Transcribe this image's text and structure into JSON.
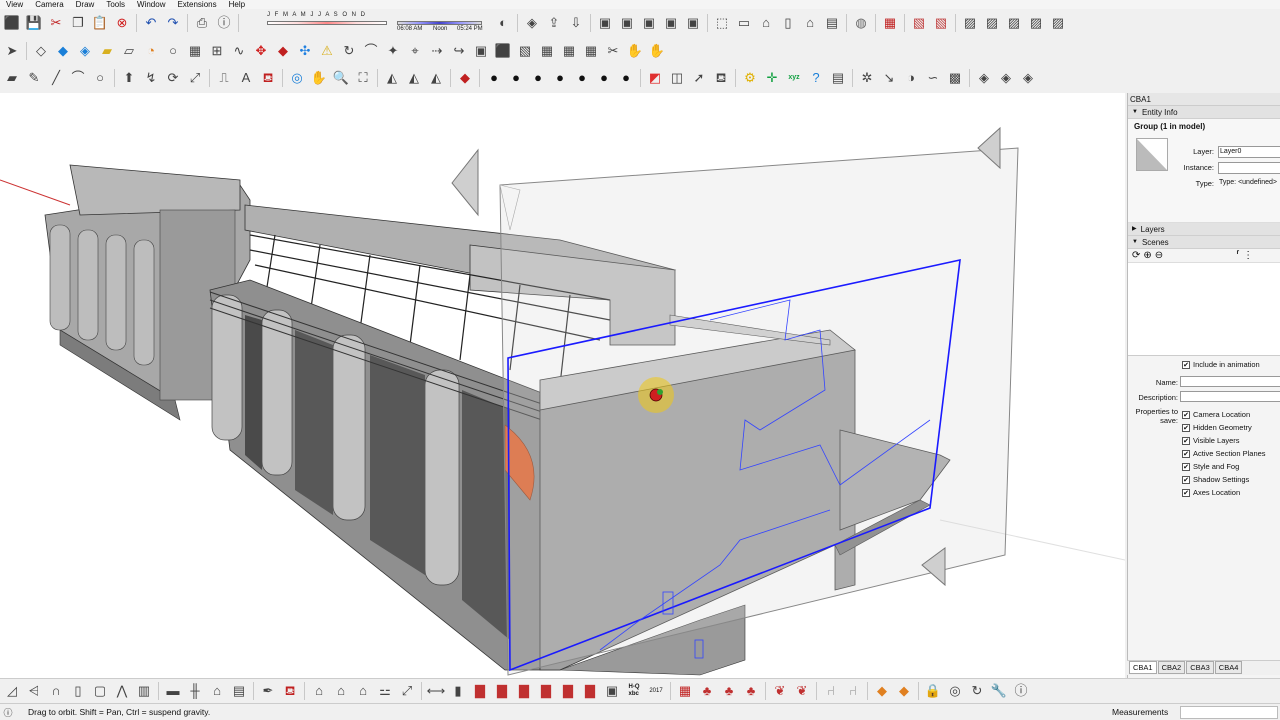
{
  "menu": [
    "View",
    "Camera",
    "Draw",
    "Tools",
    "Window",
    "Extensions",
    "Help"
  ],
  "shadow_widget": {
    "months": "J F M A M J J A S O N D",
    "sunrise": "06:08 AM",
    "noon": "Noon",
    "sunset": "05:24 PM"
  },
  "toolbar1_icons": [
    "cube-icon",
    "save-icon",
    "cut-icon",
    "copy-icon",
    "paste-icon",
    "erase-icon",
    "sep",
    "undo-icon",
    "redo-icon",
    "sep",
    "print-icon",
    "model-info-icon",
    "sep",
    "shadow-toggle-icon",
    "sep",
    "component-icon",
    "warehouse-share-icon",
    "warehouse-get-icon",
    "sep",
    "extension-icon",
    "extension-icon",
    "extension-icon",
    "extension-icon",
    "extension-icon",
    "sep",
    "iso-view-icon",
    "top-view-icon",
    "front-view-icon",
    "right-view-icon",
    "back-view-icon",
    "left-view-icon",
    "sep",
    "globe-icon",
    "sep",
    "calendar-icon",
    "sep",
    "map-icon",
    "map-icon",
    "sep",
    "photo-icon",
    "photo-icon",
    "photo-icon",
    "photo-icon",
    "photo-icon"
  ],
  "toolbar2_icons": [
    "select-icon",
    "sep",
    "orientation-icon",
    "push-icon",
    "extrude-icon",
    "fold-icon",
    "cut-face-icon",
    "round-icon",
    "circle-icon",
    "array-icon",
    "weld-icon",
    "spline-icon",
    "move-icon",
    "ruby-icon",
    "arrows-icon",
    "warning-icon",
    "loop-icon",
    "curve-icon",
    "star-icon",
    "pin-icon",
    "follow-icon",
    "redirect-icon",
    "gift-icon",
    "cube-icon",
    "image-icon",
    "grid-icon",
    "grid-icon",
    "grid-icon",
    "scissors-icon",
    "hand-icon",
    "hand-icon"
  ],
  "toolbar3_icons": [
    "eraser-icon",
    "pencil-icon",
    "line-icon",
    "arc-icon",
    "circle-icon",
    "sep",
    "pushpull-icon",
    "followme-icon",
    "rotate-icon",
    "scale-icon",
    "sep",
    "tape-icon",
    "text-icon",
    "paint-icon",
    "sep",
    "orbit-icon",
    "pan-icon",
    "zoom-icon",
    "zoom-extents-icon",
    "sep",
    "sandbox-icon",
    "sandbox-icon",
    "sandbox-icon",
    "sep",
    "ruby-icon",
    "sep",
    "style-icon",
    "style-icon",
    "style-icon",
    "style-icon",
    "style-icon",
    "style-icon",
    "style-icon",
    "sep",
    "section-icon",
    "camera-icon",
    "send-icon",
    "bucket-icon",
    "sep",
    "settings-icon",
    "axis-icon",
    "xyz-icon",
    "help-icon",
    "clipboard-icon",
    "sep",
    "cog-icon",
    "arrow-icon",
    "half-circle-icon",
    "wave-icon",
    "color-icon",
    "sep",
    "view-icon",
    "view-icon",
    "view-icon"
  ],
  "bottom_icons": [
    "ramp-icon",
    "stair-icon",
    "arch-icon",
    "door-icon",
    "window-icon",
    "truss-icon",
    "building-icon",
    "sep",
    "wood-icon",
    "rail-icon",
    "house-icon",
    "chart-icon",
    "sep",
    "pen-icon",
    "paint-icon",
    "sep",
    "roof-icon",
    "roof-icon",
    "roof-icon",
    "bone-icon",
    "scale-icon",
    "sep",
    "dimension-icon",
    "column-icon",
    "wall-icon",
    "wall-icon",
    "wall-icon",
    "wall-icon",
    "wall-icon",
    "wall-icon",
    "label-icon",
    "sep",
    "calendar-icon",
    "tree-icon",
    "tree-icon",
    "tree-icon",
    "sep",
    "plant-icon",
    "plant-icon",
    "sep",
    "chair-icon",
    "chair-icon",
    "sep",
    "layers-icon",
    "layers-icon",
    "sep",
    "lock-icon",
    "target-icon",
    "refresh-icon",
    "wrench-icon",
    "info-icon"
  ],
  "bottom_text_icons": {
    "hq": "H-Q\nxbc",
    "year": "2017"
  },
  "tray": {
    "title": "CBA1",
    "entity_info": {
      "header": "Entity Info",
      "title": "Group (1 in model)",
      "layer_label": "Layer:",
      "layer_value": "Layer0",
      "instance_label": "Instance:",
      "instance_value": "",
      "type_label": "Type:",
      "type_value": "Type: <undefined>"
    },
    "layers_header": "Layers",
    "scenes_header": "Scenes",
    "scene_props": {
      "include_label": "Include in animation",
      "name_label": "Name:",
      "description_label": "Description:",
      "properties_label": "Properties to save:",
      "properties": [
        {
          "label": "Camera Location",
          "checked": true
        },
        {
          "label": "Hidden Geometry",
          "checked": true
        },
        {
          "label": "Visible Layers",
          "checked": true
        },
        {
          "label": "Active Section Planes",
          "checked": true
        },
        {
          "label": "Style and Fog",
          "checked": true
        },
        {
          "label": "Shadow Settings",
          "checked": true
        },
        {
          "label": "Axes Location",
          "checked": true
        }
      ]
    }
  },
  "scene_tabs": [
    "CBA1",
    "CBA2",
    "CBA3",
    "CBA4"
  ],
  "status": {
    "text": "Drag to orbit. Shift = Pan, Ctrl = suspend gravity.",
    "measurements_label": "Measurements",
    "measurements_value": ""
  },
  "colors": {
    "accent": "#f0c020",
    "section_plane": "#1a1aff",
    "model_gray": "#9a9a9a",
    "background": "#ffffff"
  }
}
